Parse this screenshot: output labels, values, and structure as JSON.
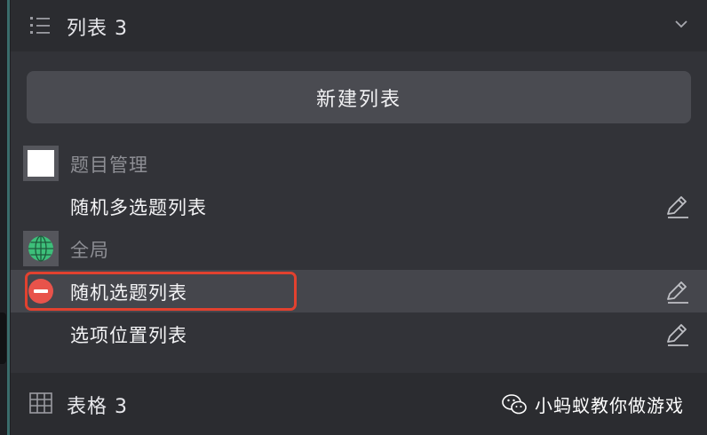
{
  "list_section": {
    "title": "列表 3"
  },
  "new_list_button": {
    "label": "新建列表"
  },
  "groups": [
    {
      "label": "题目管理",
      "icon": "white-square-icon",
      "items": [
        {
          "label": "随机多选题列表",
          "selected": false
        }
      ]
    },
    {
      "label": "全局",
      "icon": "globe-icon",
      "items": [
        {
          "label": "随机选题列表",
          "selected": true,
          "badge": "remove-icon"
        },
        {
          "label": "选项位置列表",
          "selected": false
        }
      ]
    }
  ],
  "table_section": {
    "title": "表格 3"
  },
  "watermark": {
    "text": "小蚂蚁教你做游戏"
  },
  "colors": {
    "highlight": "#e2412f",
    "remove_badge": "#e8534b",
    "globe": "#3dbf7a"
  }
}
